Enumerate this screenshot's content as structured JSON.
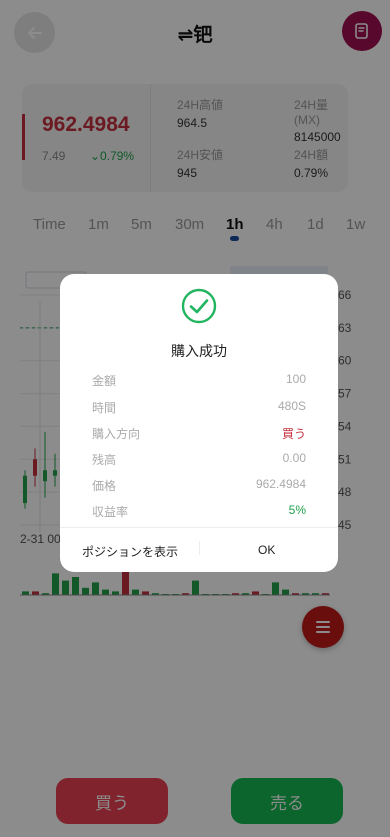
{
  "header": {
    "title": "⇌钯"
  },
  "stats": {
    "price": "962.4984",
    "change_abs": "7.49",
    "change_pct": "⌄0.79%",
    "items": [
      {
        "label": "24H高値",
        "value": "964.5"
      },
      {
        "label": "24H量(MX)",
        "value": "8145000"
      },
      {
        "label": "24H安値",
        "value": "945"
      },
      {
        "label": "24H額",
        "value": "0.79%"
      }
    ]
  },
  "tabs": [
    "Time",
    "1m",
    "5m",
    "30m",
    "1h",
    "4h",
    "1d",
    "1w"
  ],
  "active_tab": "1h",
  "chart_data": {
    "type": "candlestick",
    "y_tick_labels": [
      "66",
      "63",
      "60",
      "57",
      "54",
      "51",
      "48",
      "45"
    ],
    "x_tick_labels": [
      "2-31 00"
    ],
    "candles": [
      {
        "open": 49.5,
        "close": 47.0,
        "high": 50.0,
        "low": 46.5,
        "dir": "up"
      },
      {
        "open": 49.5,
        "close": 51.0,
        "high": 52.0,
        "low": 48.5,
        "dir": "down"
      },
      {
        "open": 50.0,
        "close": 49.0,
        "high": 53.5,
        "low": 47.5,
        "dir": "up"
      },
      {
        "open": 50.0,
        "close": 49.5,
        "high": 51.5,
        "low": 48.5,
        "dir": "up"
      },
      {
        "open": 53.0,
        "close": 50.5,
        "high": 53.5,
        "low": 49.5,
        "dir": "down"
      }
    ],
    "volume_bars": [
      {
        "v": 0.1,
        "dir": "up"
      },
      {
        "v": 0.1,
        "dir": "down"
      },
      {
        "v": 0.05,
        "dir": "up"
      },
      {
        "v": 0.6,
        "dir": "up"
      },
      {
        "v": 0.4,
        "dir": "up"
      },
      {
        "v": 0.5,
        "dir": "up"
      },
      {
        "v": 0.2,
        "dir": "up"
      },
      {
        "v": 0.35,
        "dir": "up"
      },
      {
        "v": 0.15,
        "dir": "up"
      },
      {
        "v": 0.1,
        "dir": "up"
      },
      {
        "v": 0.8,
        "dir": "down"
      },
      {
        "v": 0.15,
        "dir": "up"
      },
      {
        "v": 0.1,
        "dir": "down"
      },
      {
        "v": 0.05,
        "dir": "up"
      },
      {
        "v": 0.0,
        "dir": "up"
      },
      {
        "v": 0.0,
        "dir": "up"
      },
      {
        "v": 0.05,
        "dir": "down"
      },
      {
        "v": 0.4,
        "dir": "up"
      },
      {
        "v": 0.0,
        "dir": "up"
      },
      {
        "v": 0.0,
        "dir": "up"
      },
      {
        "v": 0.0,
        "dir": "up"
      },
      {
        "v": 0.05,
        "dir": "down"
      },
      {
        "v": 0.05,
        "dir": "up"
      },
      {
        "v": 0.1,
        "dir": "down"
      },
      {
        "v": 0.0,
        "dir": "up"
      },
      {
        "v": 0.35,
        "dir": "up"
      },
      {
        "v": 0.15,
        "dir": "up"
      },
      {
        "v": 0.05,
        "dir": "down"
      },
      {
        "v": 0.05,
        "dir": "up"
      },
      {
        "v": 0.05,
        "dir": "up"
      },
      {
        "v": 0.05,
        "dir": "down"
      }
    ],
    "dashed_level": 63,
    "colors": {
      "up": "#21a14c",
      "down": "#c4313f",
      "axis": "#bbbbbb",
      "dashed": "#21a14c"
    }
  },
  "buttons": {
    "buy": "買う",
    "sell": "売る"
  },
  "modal": {
    "title": "購入成功",
    "rows": [
      {
        "label": "金額",
        "value": "100"
      },
      {
        "label": "時間",
        "value": "480S"
      },
      {
        "label": "購入方向",
        "value": "買う"
      },
      {
        "label": "残高",
        "value": "0.00"
      },
      {
        "label": "価格",
        "value": "962.4984"
      },
      {
        "label": "収益率",
        "value": "5%"
      }
    ],
    "view_position": "ポジションを表示",
    "ok": "OK"
  },
  "colors": {
    "accent_red": "#c4313f",
    "accent_green": "#21a14c",
    "brand": "#a01050"
  }
}
